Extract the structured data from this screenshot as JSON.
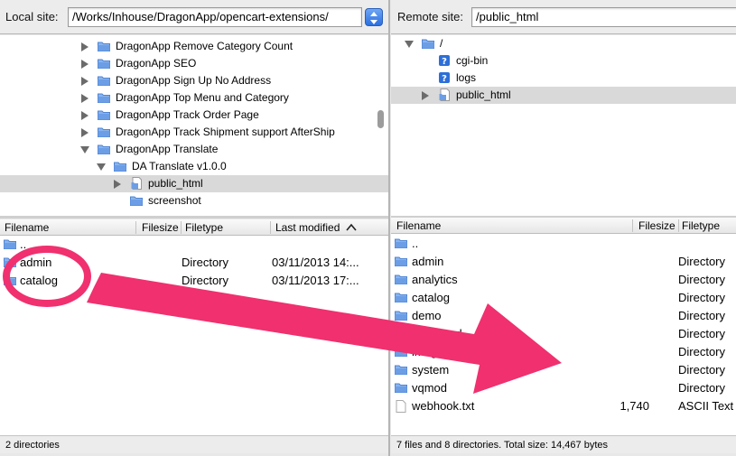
{
  "local": {
    "label": "Local site:",
    "path": "/Works/Inhouse/DragonApp/opencart-extensions/",
    "tree": [
      {
        "label": "DragonApp Remove Category Count",
        "indent": 0,
        "toggle": "right",
        "icon": "folder"
      },
      {
        "label": "DragonApp SEO",
        "indent": 0,
        "toggle": "right",
        "icon": "folder"
      },
      {
        "label": "DragonApp Sign Up No Address",
        "indent": 0,
        "toggle": "right",
        "icon": "folder"
      },
      {
        "label": "DragonApp Top Menu and Category",
        "indent": 0,
        "toggle": "right",
        "icon": "folder"
      },
      {
        "label": "DragonApp Track Order Page",
        "indent": 0,
        "toggle": "right",
        "icon": "folder"
      },
      {
        "label": "DragonApp Track Shipment support AfterShip",
        "indent": 0,
        "toggle": "right",
        "icon": "folder"
      },
      {
        "label": "DragonApp Translate",
        "indent": 0,
        "toggle": "down",
        "icon": "folder"
      },
      {
        "label": "DA Translate v1.0.0",
        "indent": 1,
        "toggle": "down",
        "icon": "folder"
      },
      {
        "label": "public_html",
        "indent": 2,
        "toggle": "right",
        "icon": "doc-folder",
        "selected": true
      },
      {
        "label": "screenshot",
        "indent": 2,
        "toggle": "none",
        "icon": "folder"
      }
    ],
    "columns": {
      "filename": "Filename",
      "filesize": "Filesize",
      "filetype": "Filetype",
      "modified": "Last modified"
    },
    "files": [
      {
        "name": "..",
        "size": "",
        "type": "",
        "modified": ""
      },
      {
        "name": "admin",
        "size": "",
        "type": "Directory",
        "modified": "03/11/2013 14:..."
      },
      {
        "name": "catalog",
        "size": "",
        "type": "Directory",
        "modified": "03/11/2013 17:..."
      }
    ],
    "status": "2 directories"
  },
  "remote": {
    "label": "Remote site:",
    "path": "/public_html",
    "tree": [
      {
        "label": "/",
        "indent": 0,
        "toggle": "down",
        "icon": "folder"
      },
      {
        "label": "cgi-bin",
        "indent": 1,
        "toggle": "none",
        "icon": "unknown"
      },
      {
        "label": "logs",
        "indent": 1,
        "toggle": "none",
        "icon": "unknown"
      },
      {
        "label": "public_html",
        "indent": 1,
        "toggle": "right",
        "icon": "doc-folder",
        "selected": true
      }
    ],
    "columns": {
      "filename": "Filename",
      "filesize": "Filesize",
      "filetype": "Filetype"
    },
    "files": [
      {
        "name": "..",
        "size": "",
        "type": "",
        "icon": "folder"
      },
      {
        "name": "admin",
        "size": "",
        "type": "Directory",
        "icon": "folder"
      },
      {
        "name": "analytics",
        "size": "",
        "type": "Directory",
        "icon": "folder"
      },
      {
        "name": "catalog",
        "size": "",
        "type": "Directory",
        "icon": "folder"
      },
      {
        "name": "demo",
        "size": "",
        "type": "Directory",
        "icon": "folder"
      },
      {
        "name": "download",
        "size": "",
        "type": "Directory",
        "icon": "folder"
      },
      {
        "name": "image",
        "size": "",
        "type": "Directory",
        "icon": "folder"
      },
      {
        "name": "system",
        "size": "",
        "type": "Directory",
        "icon": "folder"
      },
      {
        "name": "vqmod",
        "size": "",
        "type": "Directory",
        "icon": "folder"
      },
      {
        "name": "webhook.txt",
        "size": "1,740",
        "type": "ASCII Text",
        "icon": "file"
      }
    ],
    "status": "7 files and 8 directories. Total size: 14,467 bytes"
  },
  "annotation": {
    "color": "#f0306f",
    "circle": "highlight-ellipse",
    "arrow": "transfer-arrow"
  },
  "colors": {
    "folder": "#6c9ee6",
    "selection": "#d9d9d9",
    "accent": "#2a6fe0"
  }
}
